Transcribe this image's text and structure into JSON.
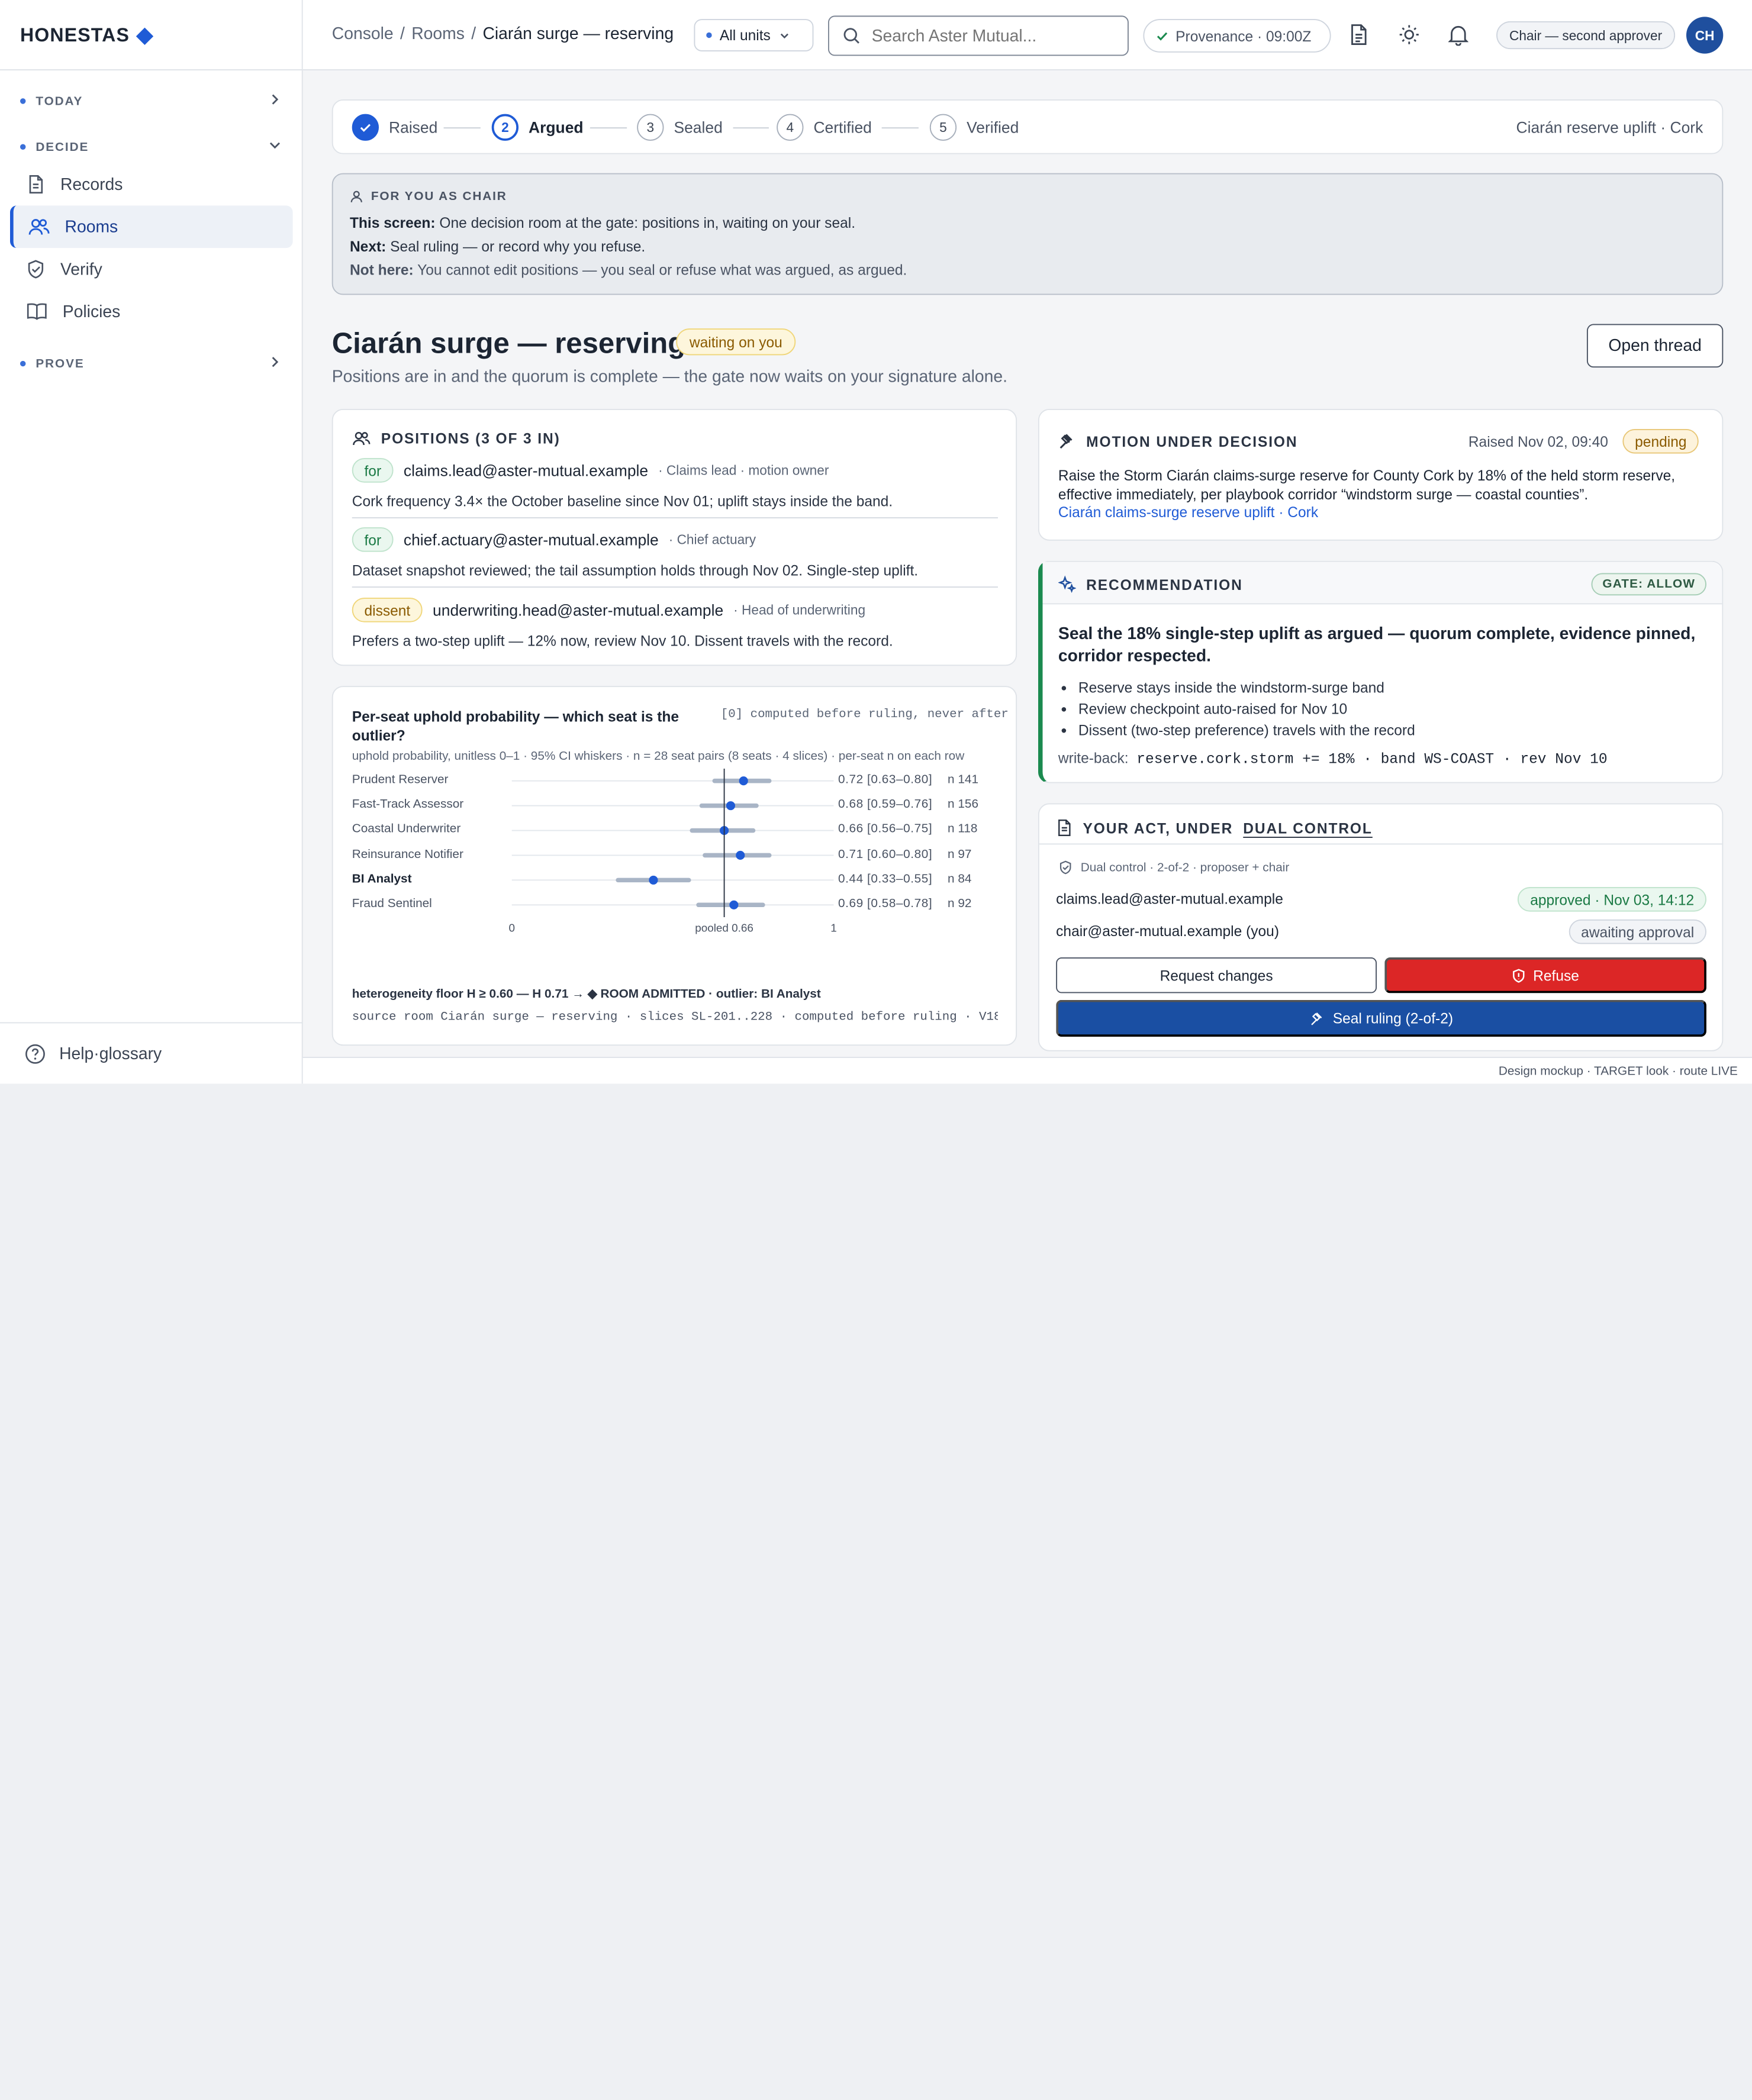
{
  "brand": {
    "name": "HONESTAS"
  },
  "sidebar": {
    "sections": [
      {
        "label": "TODAY"
      },
      {
        "label": "DECIDE"
      },
      {
        "label": "PROVE"
      }
    ],
    "items": [
      {
        "label": "Records",
        "icon": "document-icon"
      },
      {
        "label": "Rooms",
        "icon": "users-icon",
        "active": true
      },
      {
        "label": "Verify",
        "icon": "shield-check-icon"
      },
      {
        "label": "Policies",
        "icon": "book-icon"
      }
    ],
    "help": "Help·glossary"
  },
  "topbar": {
    "breadcrumbs": [
      "Console",
      "Rooms",
      "Ciarán surge — reserving"
    ],
    "units_select": "All units",
    "search_placeholder": "Search Aster Mutual...",
    "provenance": "Provenance · 09:00Z",
    "role_chip": "Chair — second approver",
    "avatar_initials": "CH"
  },
  "stepper": {
    "steps": [
      {
        "num": "1",
        "label": "Raised",
        "state": "done"
      },
      {
        "num": "2",
        "label": "Argued",
        "state": "current"
      },
      {
        "num": "3",
        "label": "Sealed",
        "state": "todo"
      },
      {
        "num": "4",
        "label": "Certified",
        "state": "todo"
      },
      {
        "num": "5",
        "label": "Verified",
        "state": "todo"
      }
    ],
    "context": "Ciarán reserve uplift · Cork"
  },
  "for_you": {
    "heading": "FOR YOU AS CHAIR",
    "this_screen_label": "This screen:",
    "this_screen": "One decision room at the gate: positions in, waiting on your seal.",
    "next_label": "Next:",
    "next": "Seal ruling — or record why you refuse.",
    "not_here_label": "Not here:",
    "not_here": "You cannot edit positions — you seal or refuse what was argued, as argued."
  },
  "page": {
    "title": "Ciarán surge — reserving",
    "status_badge": "waiting on you",
    "subtitle": "Positions are in and the quorum is complete — the gate now waits on your signature alone.",
    "open_thread": "Open thread"
  },
  "positions": {
    "heading": "POSITIONS (3 OF 3 IN)",
    "items": [
      {
        "stance": "for",
        "who": "claims.lead@aster-mutual.example",
        "role": "· Claims lead · motion owner",
        "text": "Cork frequency 3.4× the October baseline since Nov 01; uplift stays inside the band."
      },
      {
        "stance": "for",
        "who": "chief.actuary@aster-mutual.example",
        "role": "· Chief actuary",
        "text": "Dataset snapshot reviewed; the tail assumption holds through Nov 02. Single-step uplift."
      },
      {
        "stance": "dissent",
        "who": "underwriting.head@aster-mutual.example",
        "role": "· Head of underwriting",
        "text": "Prefers a two-step uplift — 12% now, review Nov 10. Dissent travels with the record."
      }
    ]
  },
  "chart_data": {
    "type": "scatter",
    "title": "Per-seat uphold probability — which seat is the outlier?",
    "note": "[0] computed before ruling, never after",
    "subtitle": "uphold probability, unitless 0–1 · 95% CI whiskers · n = 28 seat pairs (8 seats · 4 slices) · per-seat n on each row",
    "xlim": [
      0,
      1
    ],
    "x_ticks": [
      "0",
      "pooled 0.66",
      "1"
    ],
    "pooled": 0.66,
    "rows": [
      {
        "label": "Prudent Reserver",
        "value": 0.72,
        "lo": 0.63,
        "hi": 0.8,
        "text": "0.72 [0.63–0.80]",
        "n": "n 141"
      },
      {
        "label": "Fast-Track Assessor",
        "value": 0.68,
        "lo": 0.59,
        "hi": 0.76,
        "text": "0.68 [0.59–0.76]",
        "n": "n 156"
      },
      {
        "label": "Coastal Underwriter",
        "value": 0.66,
        "lo": 0.56,
        "hi": 0.75,
        "text": "0.66 [0.56–0.75]",
        "n": "n 118"
      },
      {
        "label": "Reinsurance Notifier",
        "value": 0.71,
        "lo": 0.6,
        "hi": 0.8,
        "text": "0.71 [0.60–0.80]",
        "n": "n 97"
      },
      {
        "label": "BI Analyst",
        "value": 0.44,
        "lo": 0.33,
        "hi": 0.55,
        "text": "0.44 [0.33–0.55]",
        "n": "n 84",
        "bold": true
      },
      {
        "label": "Fraud Sentinel",
        "value": 0.69,
        "lo": 0.58,
        "hi": 0.78,
        "text": "0.69 [0.58–0.78]",
        "n": "n 92"
      }
    ],
    "heterogeneity": "heterogeneity floor H ≥ 0.60 — H 0.71 → ◆ ROOM ADMITTED · outlier: BI Analyst",
    "source": "source room Ciarán surge — reserving · slices SL-201..228 · computed before ruling · V18 …",
    "colors": {
      "point": "#1f5bd6",
      "whisker": "#a9b5c6",
      "outlier_whisker": "#9aa9bf"
    }
  },
  "motion": {
    "heading": "MOTION UNDER DECISION",
    "raised": "Raised Nov 02, 09:40",
    "status": "pending",
    "body": "Raise the Storm Ciarán claims-surge reserve for County Cork by 18% of the held storm reserve, effective immediately, per playbook corridor “windstorm surge — coastal counties”.",
    "link": "Ciarán claims-surge reserve uplift · Cork"
  },
  "recommendation": {
    "heading": "RECOMMENDATION",
    "gate": "GATE: ALLOW",
    "headline": "Seal the 18% single-step uplift as argued — quorum complete, evidence pinned, corridor respected.",
    "bullets": [
      "Reserve stays inside the windstorm-surge band",
      "Review checkpoint auto-raised for Nov 10",
      "Dissent (two-step preference) travels with the record"
    ],
    "writeback_label": "write-back:",
    "writeback_code": "reserve.cork.storm += 18% · band WS-COAST · rev Nov 10"
  },
  "act": {
    "heading_prefix": "YOUR ACT, UNDER",
    "heading_link": "DUAL CONTROL",
    "dual_control": "Dual control · 2-of-2 · proposer + chair",
    "approvers": [
      {
        "who": "claims.lead@aster-mutual.example",
        "status": "approved · Nov 03, 14:12"
      },
      {
        "who": "chair@aster-mutual.example (you)",
        "status": "awaiting approval"
      }
    ],
    "request_changes": "Request changes",
    "refuse": "Refuse",
    "seal": "Seal ruling (2-of-2)"
  },
  "footer": "Design mockup · TARGET look · route LIVE"
}
